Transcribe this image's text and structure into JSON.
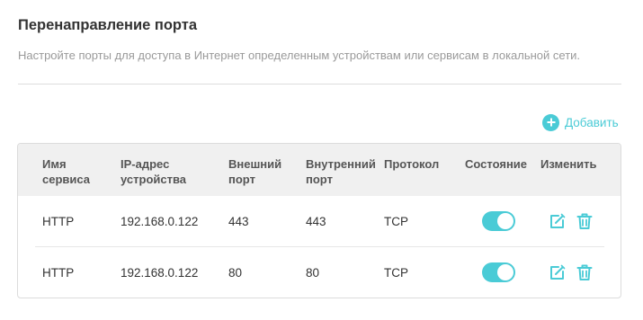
{
  "header": {
    "title": "Перенаправление порта",
    "description": "Настройте порты для доступа в Интернет определенным устройствам или сервисам в локальной сети."
  },
  "toolbar": {
    "add_label": "Добавить",
    "add_icon": "plus-circle-icon"
  },
  "table": {
    "columns": [
      "Имя сервиса",
      "IP-адрес устройства",
      "Внешний порт",
      "Внутренний порт",
      "Протокол",
      "Состояние",
      "Изменить"
    ],
    "rows": [
      {
        "service": "HTTP",
        "ip": "192.168.0.122",
        "external_port": "443",
        "internal_port": "443",
        "protocol": "TCP",
        "enabled": true
      },
      {
        "service": "HTTP",
        "ip": "192.168.0.122",
        "external_port": "80",
        "internal_port": "80",
        "protocol": "TCP",
        "enabled": true
      }
    ],
    "edit_icon": "edit-icon",
    "delete_icon": "trash-icon"
  },
  "colors": {
    "accent": "#4acbd6",
    "header_bg": "#f0f0f0",
    "description": "#9a9a9a"
  }
}
